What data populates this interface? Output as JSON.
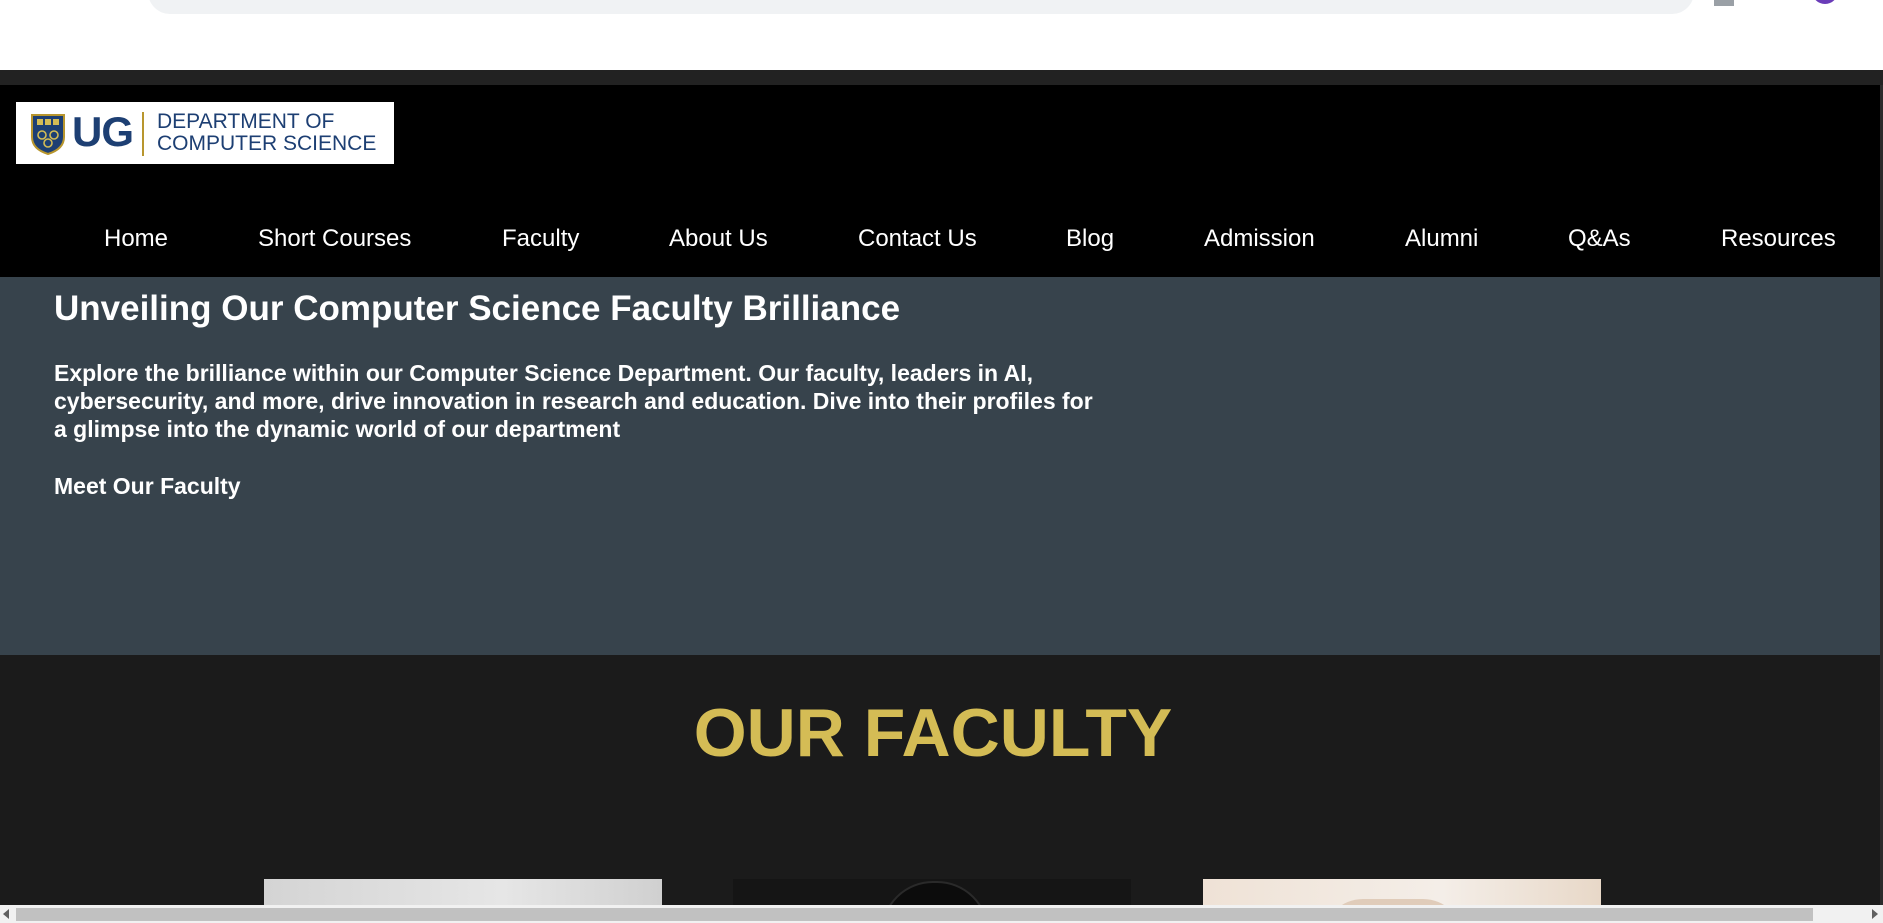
{
  "logo": {
    "short": "UG",
    "line1": "DEPARTMENT OF",
    "line2": "COMPUTER SCIENCE",
    "crest_icon": "university-crest-icon"
  },
  "nav": {
    "items": [
      {
        "label": "Home"
      },
      {
        "label": "Short Courses"
      },
      {
        "label": "Faculty"
      },
      {
        "label": "About Us"
      },
      {
        "label": "Contact Us"
      },
      {
        "label": "Blog"
      },
      {
        "label": "Admission"
      },
      {
        "label": "Alumni"
      },
      {
        "label": "Q&As"
      },
      {
        "label": "Resources"
      }
    ]
  },
  "hero": {
    "title": "Unveiling Our Computer Science Faculty Brilliance",
    "text": "Explore the brilliance within our Computer Science Department. Our faculty, leaders in AI, cybersecurity, and more, drive innovation in research and education. Dive into their profiles for a glimpse into the dynamic world of our department",
    "link": "Meet Our Faculty"
  },
  "faculty": {
    "title": "OUR FACULTY"
  },
  "colors": {
    "topbar": "#000000",
    "hero_bg": "#37434c",
    "faculty_bg": "#1b1b1b",
    "accent_gold": "#d4bc55",
    "logo_blue": "#1d3f73"
  }
}
